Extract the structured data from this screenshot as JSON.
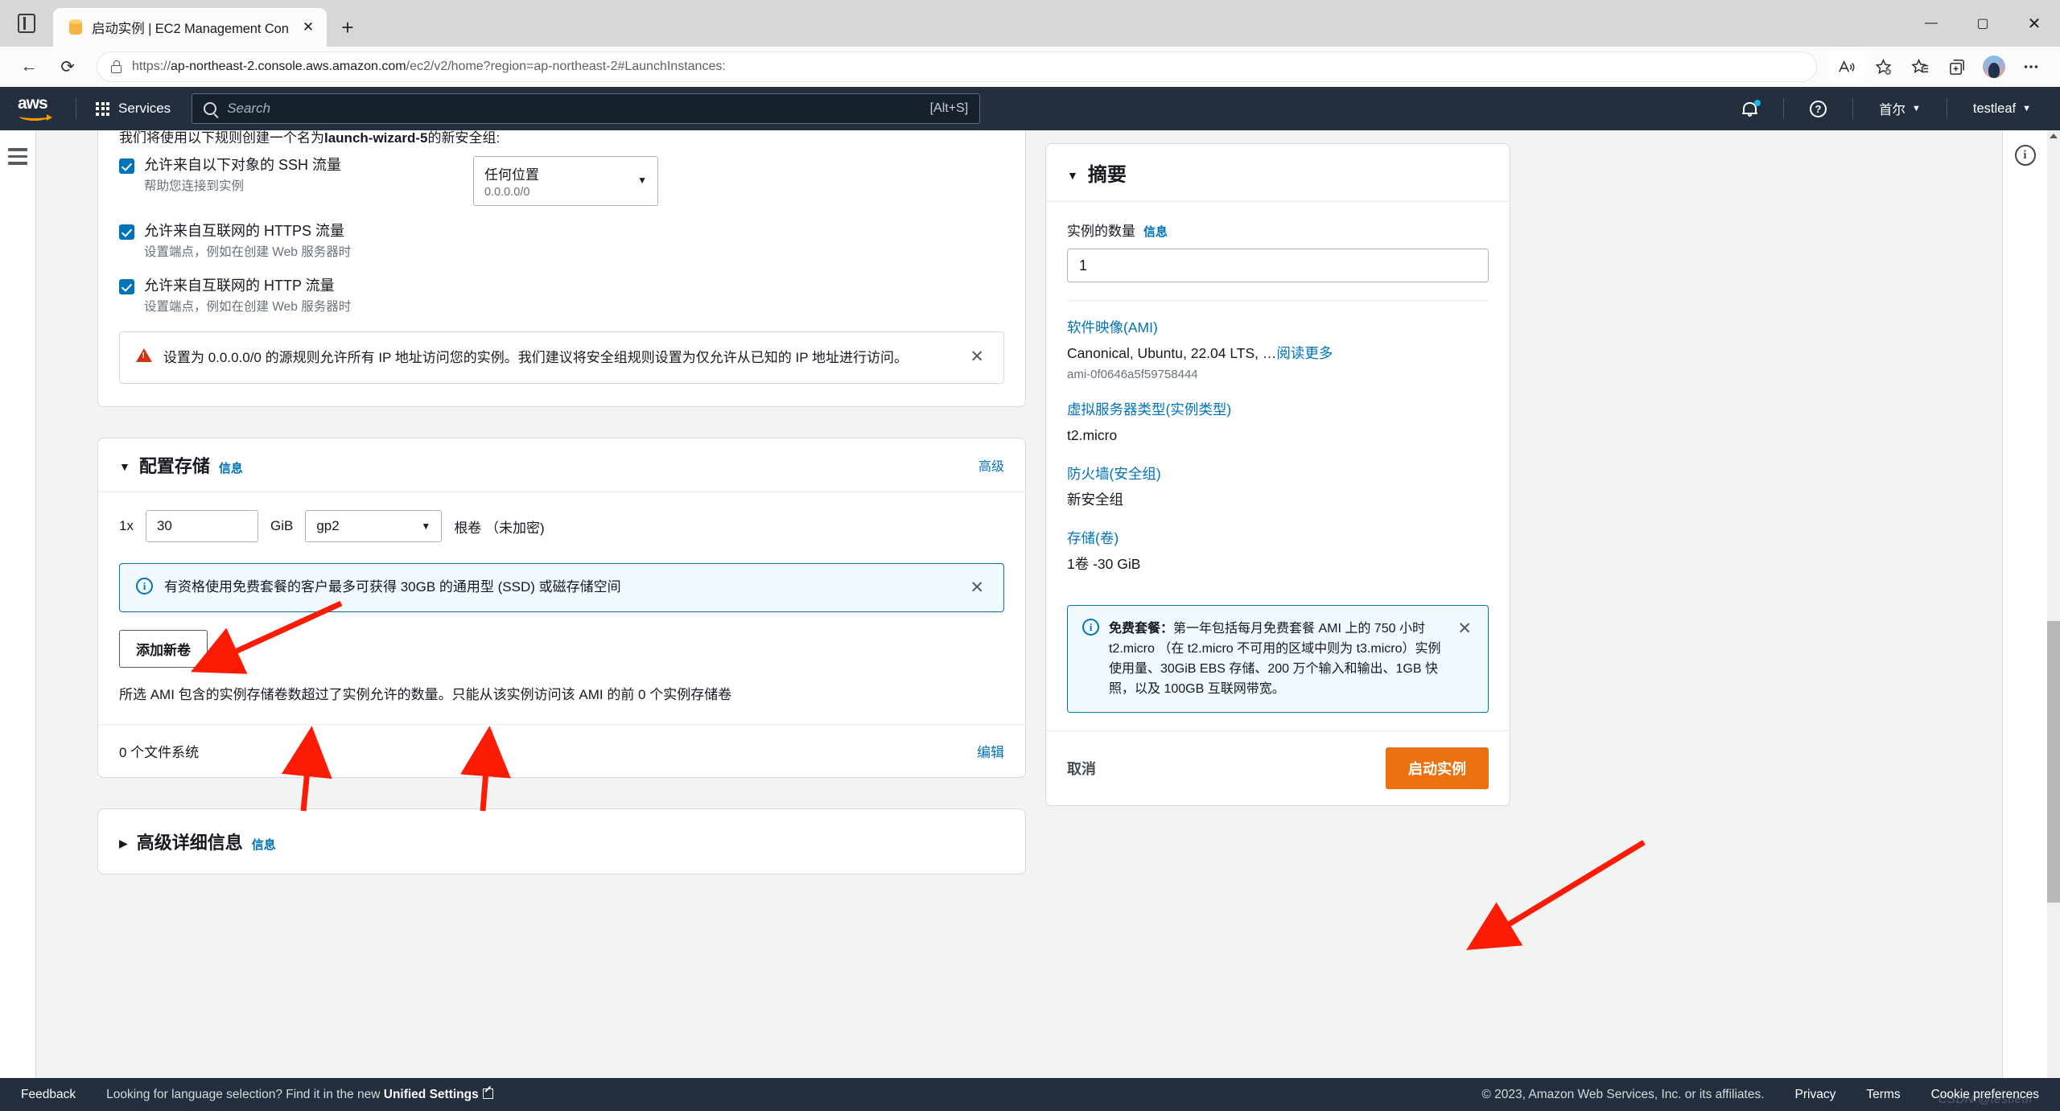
{
  "browser": {
    "tab_title": "启动实例 | EC2 Management Con",
    "tab_favicon": "storage-can-icon",
    "new_tab_label": "+",
    "close_tab_label": "✕",
    "url_protocol": "https://",
    "url_host": "ap-northeast-2.console.aws.amazon.com",
    "url_path": "/ec2/v2/home?region=ap-northeast-2#LaunchInstances:",
    "back_label": "←",
    "reload_label": "⟳",
    "minimize_label": "—",
    "maximize_label": "▢",
    "close_window_label": "✕",
    "toolbar_icons": [
      "read-aloud-icon",
      "add-favorite-icon",
      "favorites-icon",
      "collections-icon",
      "profile-avatar-icon",
      "settings-more-icon"
    ]
  },
  "aws_header": {
    "logo_text": "aws",
    "services_label": "Services",
    "search_placeholder": "Search",
    "search_shortcut": "[Alt+S]",
    "region_label": "首尔",
    "account_label": "testleaf",
    "caret": "▼",
    "help_glyph": "?",
    "notification_dot_color": "#19b7e7"
  },
  "security_group": {
    "intro_prefix": "我们将使用以下规则创建一个名为",
    "intro_name": "launch-wizard-5",
    "intro_suffix": "的新安全组:",
    "rules": [
      {
        "title": "允许来自以下对象的 SSH 流量",
        "subtitle": "帮助您连接到实例",
        "checked": true,
        "has_select": true
      },
      {
        "title": "允许来自互联网的 HTTPS 流量",
        "subtitle": "设置端点，例如在创建 Web 服务器时",
        "checked": true,
        "has_select": false
      },
      {
        "title": "允许来自互联网的 HTTP 流量",
        "subtitle": "设置端点，例如在创建 Web 服务器时",
        "checked": true,
        "has_select": false
      }
    ],
    "source_select_value": "任何位置",
    "source_select_cidr": "0.0.0.0/0",
    "warning_text": "设置为 0.0.0.0/0 的源规则允许所有 IP 地址访问您的实例。我们建议将安全组规则设置为仅允许从已知的 IP 地址进行访问。",
    "warning_close": "✕"
  },
  "storage": {
    "section_title": "配置存储",
    "info_label": "信息",
    "advanced_label": "高级",
    "volume_count": "1x",
    "volume_size": "30",
    "volume_unit": "GiB",
    "volume_type": "gp2",
    "volume_role": "根卷 （未加密)",
    "free_tier_banner": "有资格使用免费套餐的客户最多可获得 30GB 的通用型 (SSD) 或磁存储空间",
    "banner_close": "✕",
    "add_volume_label": "添加新卷",
    "ami_note": "所选 AMI 包含的实例存储卷数超过了实例允许的数量。只能从该实例访问该 AMI 的前 0 个实例存储卷",
    "filesystem_count": "0 个文件系统",
    "edit_label": "编辑"
  },
  "advanced_details": {
    "title": "高级详细信息",
    "info_label": "信息",
    "collapsed_twisty": "▶"
  },
  "summary": {
    "title": "摘要",
    "twisty": "▼",
    "instance_count_label": "实例的数量",
    "info_label": "信息",
    "instance_count_value": "1",
    "items": [
      {
        "link": "软件映像(AMI)",
        "value": "Canonical, Ubuntu, 22.04 LTS, …",
        "read_more": "阅读更多",
        "sub": "ami-0f0646a5f59758444"
      },
      {
        "link": "虚拟服务器类型(实例类型)",
        "value": "t2.micro",
        "read_more": "",
        "sub": ""
      },
      {
        "link": "防火墙(安全组)",
        "value": "新安全组",
        "read_more": "",
        "sub": ""
      },
      {
        "link": "存储(卷)",
        "value": "1卷 -30 GiB",
        "read_more": "",
        "sub": ""
      }
    ],
    "free_tier_label": "免费套餐：",
    "free_tier_text": "第一年包括每月免费套餐 AMI 上的 750 小时 t2.micro （在 t2.micro 不可用的区域中则为 t3.micro）实例使用量、30GiB EBS 存储、200 万个输入和输出、1GB 快照，以及 100GB 互联网带宽。",
    "free_tier_close": "✕",
    "cancel_label": "取消",
    "launch_label": "启动实例",
    "launch_color": "#ec7211"
  },
  "footer": {
    "feedback_label": "Feedback",
    "language_note_prefix": "Looking for language selection? Find it in the new ",
    "language_note_link": "Unified Settings",
    "copyright": "© 2023, Amazon Web Services, Inc. or its affiliates.",
    "privacy_label": "Privacy",
    "terms_label": "Terms",
    "cookie_label": "Cookie preferences",
    "watermark": "CSDN @testleaf"
  },
  "right_rail": {
    "info_glyph": "i"
  }
}
